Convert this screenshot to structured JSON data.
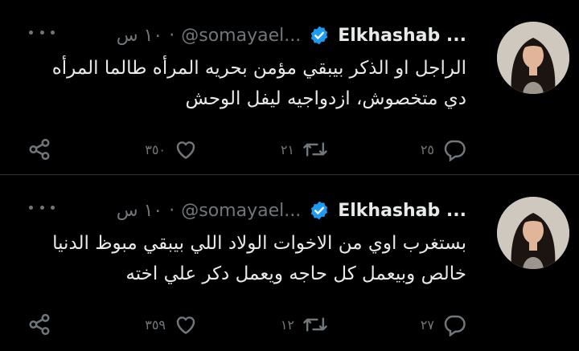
{
  "tweets": [
    {
      "name": "Elkhashab ...",
      "handle": "@somayael...",
      "dot": "·",
      "time": "١٠ س",
      "text": "الراجل او الذكر بيبقي مؤمن بحريه المرأه طالما المرأه دي متخصوش، ازدواجيه ليفل الوحش",
      "counts": {
        "reply": "٢٥",
        "retweet": "٢١",
        "like": "٣٥٠"
      }
    },
    {
      "name": "Elkhashab ...",
      "handle": "@somayael...",
      "dot": "·",
      "time": "١٠ س",
      "text": "بستغرب اوي من الاخوات الولاد اللي بيبقي مبوظ الدنيا خالص وبيعمل كل حاجه ويعمل دكر علي اخته",
      "counts": {
        "reply": "٢٧",
        "retweet": "١٢",
        "like": "٣٥٩"
      }
    }
  ],
  "icons": {
    "more": "more-icon",
    "verified": "verified-badge-icon",
    "reply": "reply-icon",
    "retweet": "retweet-icon",
    "like": "like-icon",
    "share": "share-icon"
  },
  "colors": {
    "background": "#000000",
    "text": "#e7e9ea",
    "muted": "#71767b",
    "verified": "#1d9bf0"
  }
}
